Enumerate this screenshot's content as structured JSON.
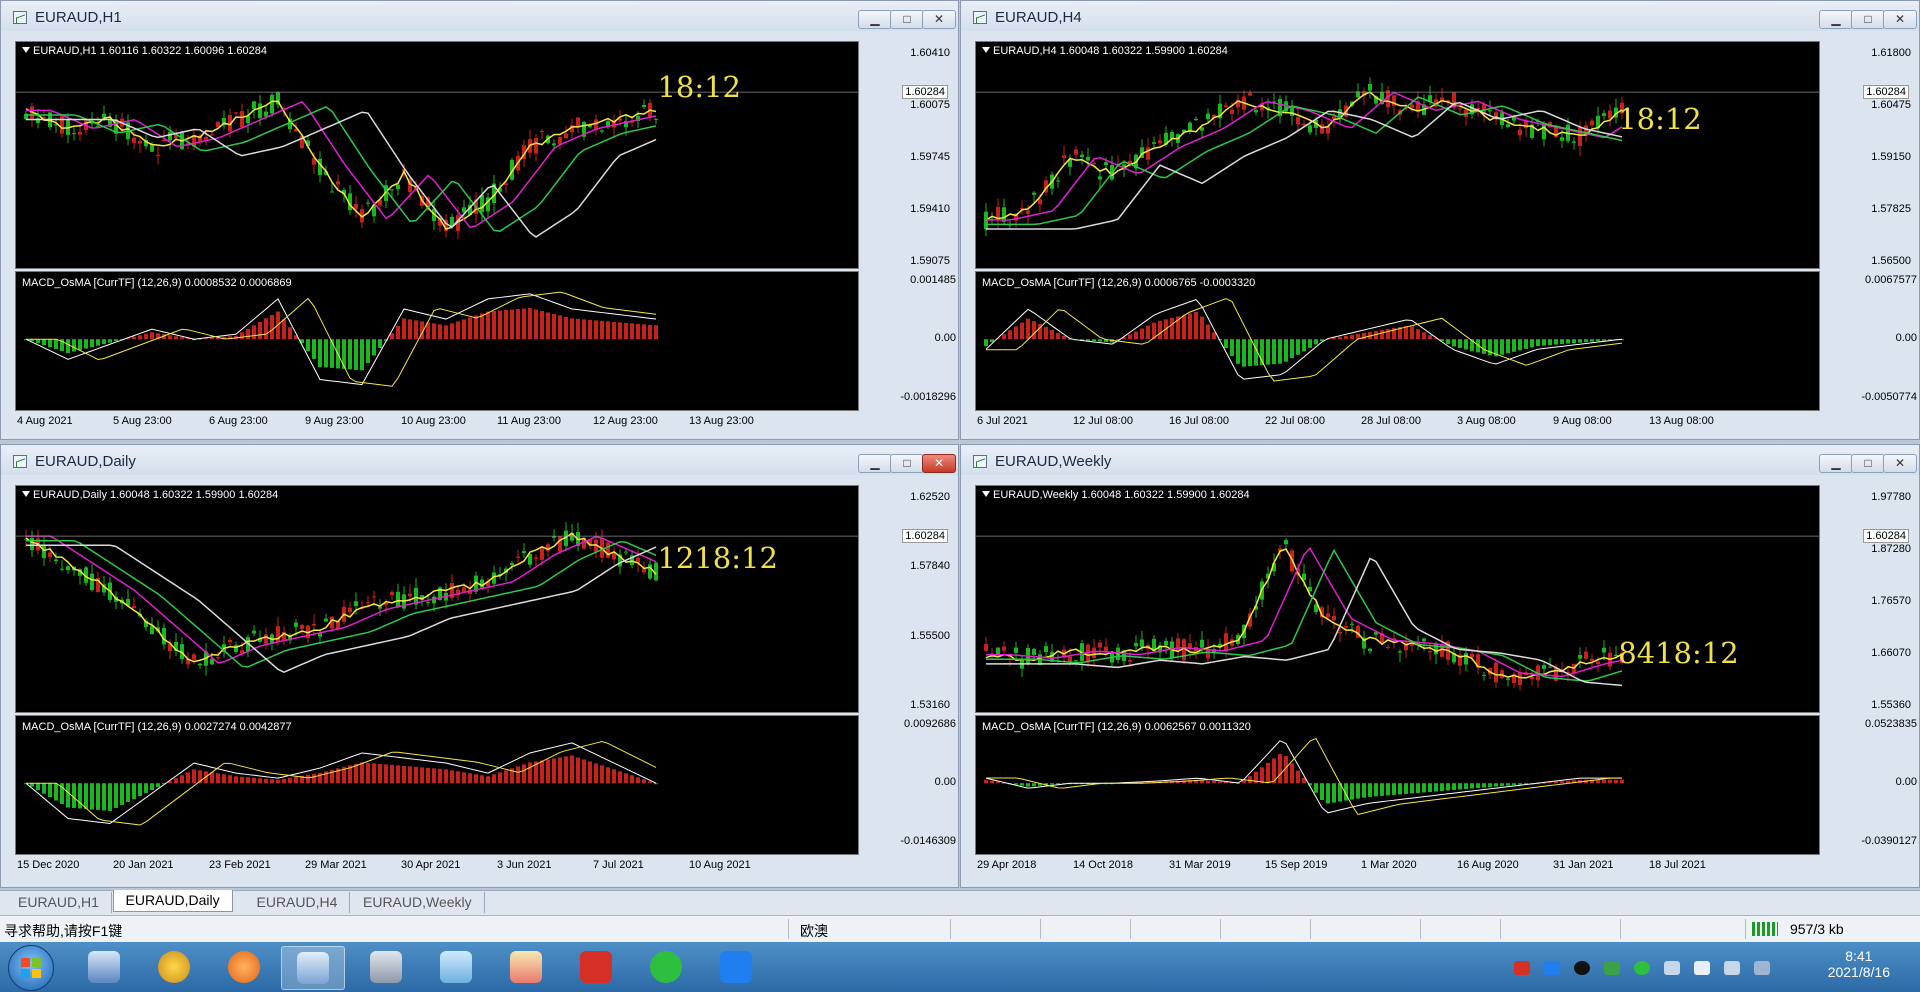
{
  "windows": [
    {
      "id": "h1",
      "title": "EURAUD,H1",
      "header": "EURAUD,H1  1.60116 1.60322 1.60096 1.60284",
      "clock": "18:12",
      "price_labels": [
        "1.60410",
        "1.60075",
        "1.59745",
        "1.59410",
        "1.59075"
      ],
      "price_current": "1.60284",
      "macd": "MACD_OsMA [CurrTF] (12,26,9) 0.0008532 0.0006869",
      "macd_labels": [
        "0.001485",
        "0.00",
        "-0.0018296"
      ],
      "dates": [
        "4 Aug 2021",
        "5 Aug 23:00",
        "6 Aug 23:00",
        "9 Aug 23:00",
        "10 Aug 23:00",
        "11 Aug 23:00",
        "12 Aug 23:00",
        "13 Aug 23:00"
      ]
    },
    {
      "id": "h4",
      "title": "EURAUD,H4",
      "header": "EURAUD,H4  1.60048 1.60322 1.59900 1.60284",
      "clock": "18:12",
      "price_labels": [
        "1.61800",
        "1.60475",
        "1.59150",
        "1.57825",
        "1.56500"
      ],
      "price_current": "1.60284",
      "macd": "MACD_OsMA [CurrTF] (12,26,9) 0.0006765 -0.0003320",
      "macd_labels": [
        "0.0067577",
        "0.00",
        "-0.0050774"
      ],
      "dates": [
        "6 Jul 2021",
        "12 Jul 08:00",
        "16 Jul 08:00",
        "22 Jul 08:00",
        "28 Jul 08:00",
        "3 Aug 08:00",
        "9 Aug 08:00",
        "13 Aug 08:00"
      ]
    },
    {
      "id": "d1",
      "title": "EURAUD,Daily",
      "header": "EURAUD,Daily  1.60048 1.60322 1.59900 1.60284",
      "clock": "1218:12",
      "price_labels": [
        "1.62520",
        "1.57840",
        "1.55500",
        "1.53160"
      ],
      "price_current": "1.60284",
      "macd": "MACD_OsMA [CurrTF] (12,26,9) 0.0027274 0.0042877",
      "macd_labels": [
        "0.0092686",
        "0.00",
        "-0.0146309"
      ],
      "dates": [
        "15 Dec 2020",
        "20 Jan 2021",
        "23 Feb 2021",
        "29 Mar 2021",
        "30 Apr 2021",
        "3 Jun 2021",
        "7 Jul 2021",
        "10 Aug 2021"
      ]
    },
    {
      "id": "w1",
      "title": "EURAUD,Weekly",
      "header": "EURAUD,Weekly  1.60048 1.60322 1.59900 1.60284",
      "clock": "8418:12",
      "price_labels": [
        "1.97780",
        "1.87280",
        "1.76570",
        "1.66070",
        "1.55360"
      ],
      "price_current": "1.60284",
      "macd": "MACD_OsMA [CurrTF] (12,26,9) 0.0062567 0.0011320",
      "macd_labels": [
        "0.0523835",
        "0.00",
        "-0.0390127"
      ],
      "dates": [
        "29 Apr 2018",
        "14 Oct 2018",
        "31 Mar 2019",
        "15 Sep 2019",
        "1 Mar 2020",
        "16 Aug 2020",
        "31 Jan 2021",
        "18 Jul 2021"
      ]
    }
  ],
  "tabs": [
    "EURAUD,H1",
    "EURAUD,Daily",
    "EURAUD,H4",
    "EURAUD,Weekly"
  ],
  "active_tab": "EURAUD,Daily",
  "status": {
    "help": "寻求帮助,请按F1键",
    "profile": "欧澳",
    "traffic": "957/3 kb"
  },
  "clock": {
    "time": "8:41",
    "date": "2021/8/16"
  },
  "window_buttons": {
    "minimize": "▁",
    "maximize": "□",
    "close": "✕"
  },
  "icons": {
    "start": "windows-start-icon",
    "tray": [
      "wps-tray-icon",
      "cloud-tray-icon",
      "qq-tray-icon",
      "security-tray-icon",
      "wechat-tray-icon",
      "network-tray-icon",
      "volume-tray-icon",
      "keyboard-tray-icon",
      "battery-tray-icon"
    ]
  },
  "colors": {
    "bull": "#c8201c",
    "bear": "#18b81e",
    "ma_yellow": "#f5e843",
    "ma_magenta": "#e01fd0",
    "ma_green": "#2dc84a",
    "ma_white": "#dcdcdc",
    "clock": "#f0e14a"
  }
}
